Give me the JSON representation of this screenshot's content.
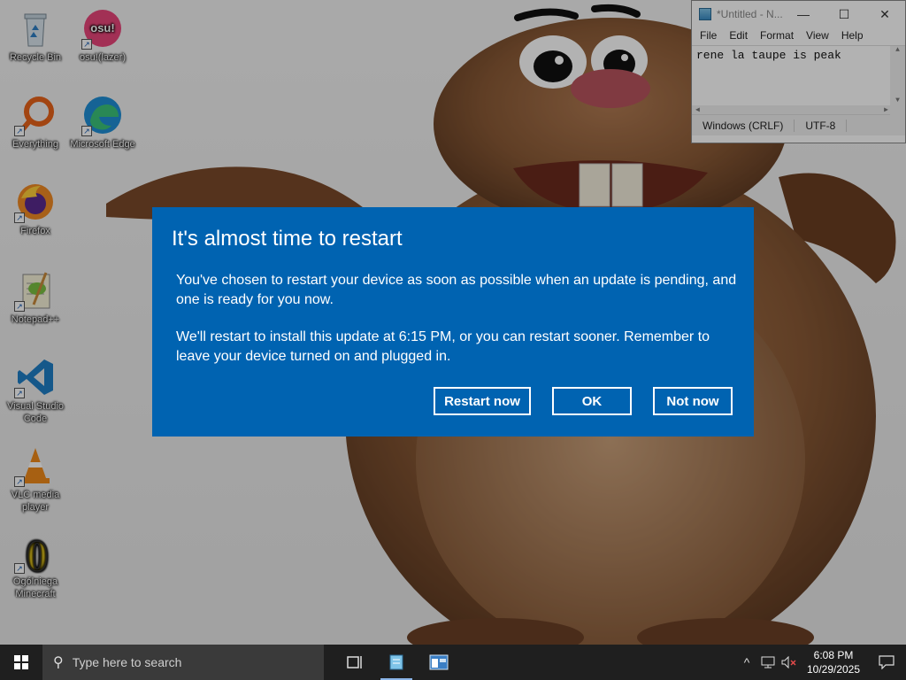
{
  "desktop": {
    "icons": [
      {
        "label": "Recycle Bin"
      },
      {
        "label": "osu!(lazer)",
        "glyph": "osu!"
      },
      {
        "label": "Everything"
      },
      {
        "label": "Microsoft Edge"
      },
      {
        "label": "Firefox"
      },
      {
        "label": "Notepad++"
      },
      {
        "label": "Visual Studio Code"
      },
      {
        "label": "VLC media player"
      },
      {
        "label": "Ogólniega Minecraft",
        "glyph": "0"
      }
    ]
  },
  "notepad": {
    "title": "*Untitled - N...",
    "controls": {
      "minimize": "—",
      "maximize": "☐",
      "close": "✕"
    },
    "menu": [
      "File",
      "Edit",
      "Format",
      "View",
      "Help"
    ],
    "content": "rene la taupe is peak",
    "status": {
      "line_ending": "Windows (CRLF)",
      "encoding": "UTF-8"
    }
  },
  "dialog": {
    "title": "It's almost time to restart",
    "paragraph1": "You've chosen to restart your device as soon as possible when an update is pending, and one is ready for you now.",
    "paragraph2": "We'll restart to install this update at 6:15 PM, or you can restart sooner. Remember to leave your device turned on and plugged in.",
    "buttons": {
      "restart": "Restart now",
      "ok": "OK",
      "not_now": "Not now"
    },
    "bg_color": "#0063b1"
  },
  "taskbar": {
    "search_placeholder": "Type here to search",
    "apps": [
      "task-view",
      "notepad",
      "app-window"
    ],
    "tray": {
      "chevron": "^",
      "network": "network-icon",
      "volume": "volume-muted-icon"
    },
    "clock": {
      "time": "6:08 PM",
      "date": "10/29/2025"
    }
  }
}
